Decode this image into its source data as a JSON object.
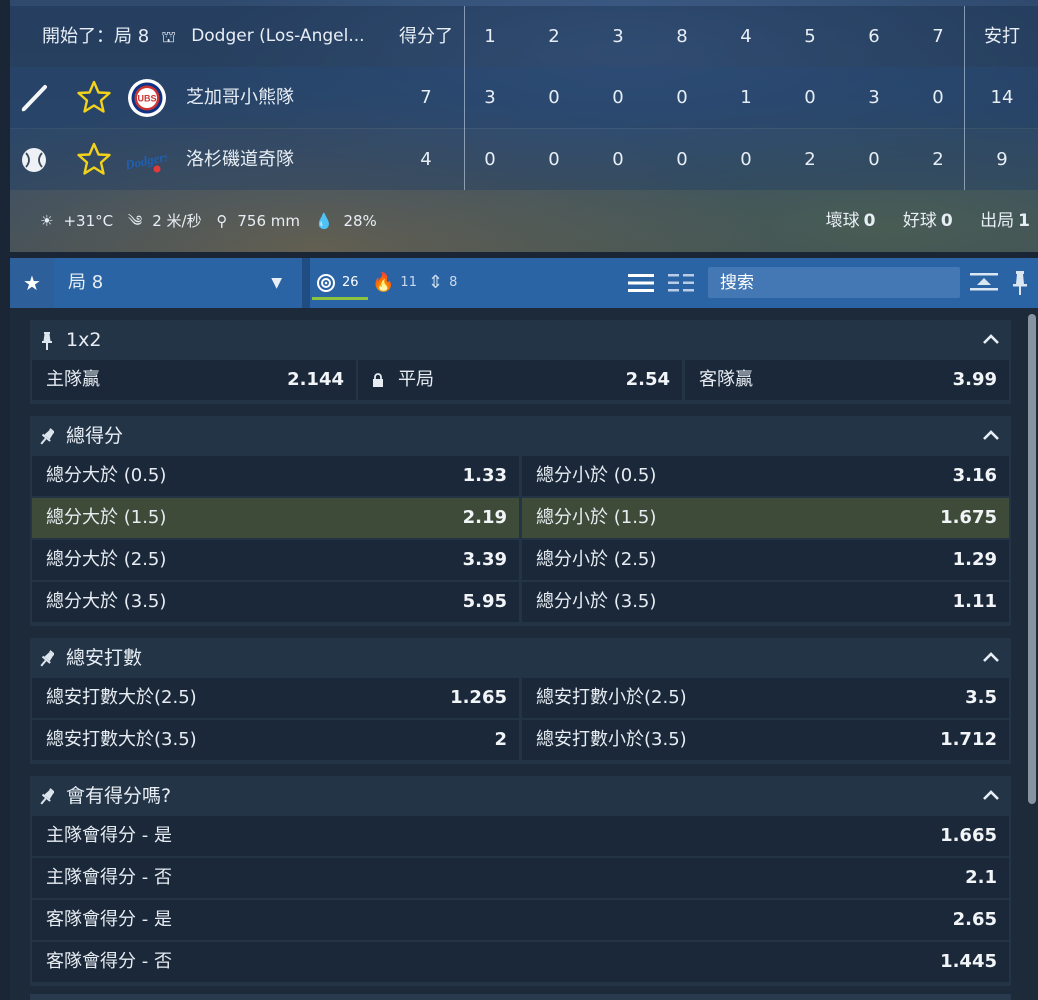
{
  "scoreboard": {
    "status": "開始了：局 8",
    "match": "Dodger (Los-Angel...",
    "runs_header": "得分了",
    "innings": [
      "1",
      "2",
      "3",
      "8",
      "4",
      "5",
      "6",
      "7"
    ],
    "hits_header": "安打",
    "home": {
      "name": "芝加哥小熊隊",
      "runs": "7",
      "scores": [
        "3",
        "0",
        "0",
        "0",
        "1",
        "0",
        "3",
        "0"
      ],
      "hits": "14",
      "logo": "Cubs"
    },
    "away": {
      "name": "洛杉磯道奇隊",
      "runs": "4",
      "scores": [
        "0",
        "0",
        "0",
        "0",
        "0",
        "2",
        "0",
        "2"
      ],
      "hits": "9",
      "logo": "Dodgers"
    },
    "weather": {
      "temp": "+31°C",
      "wind": "2 米/秒",
      "pressure": "756 mm",
      "humidity": "28%"
    },
    "counts": {
      "balls_label": "壞球",
      "balls": "0",
      "strikes_label": "好球",
      "strikes": "0",
      "outs_label": "出局",
      "outs": "1"
    }
  },
  "toolbar": {
    "inning": "局 8",
    "filter_all": "26",
    "filter_hot": "11",
    "filter_sort": "8",
    "search_placeholder": "搜索"
  },
  "markets": [
    {
      "title": "1x2",
      "rows": [
        [
          {
            "label": "主隊贏",
            "value": "2.144"
          },
          {
            "label": "平局",
            "value": "2.54",
            "locked": true
          },
          {
            "label": "客隊贏",
            "value": "3.99"
          }
        ]
      ]
    },
    {
      "title": "總得分",
      "rows": [
        [
          {
            "label": "總分大於 (0.5)",
            "value": "1.33"
          },
          {
            "label": "總分小於 (0.5)",
            "value": "3.16"
          }
        ],
        [
          {
            "label": "總分大於 (1.5)",
            "value": "2.19"
          },
          {
            "label": "總分小於 (1.5)",
            "value": "1.675"
          }
        ],
        [
          {
            "label": "總分大於 (2.5)",
            "value": "3.39"
          },
          {
            "label": "總分小於 (2.5)",
            "value": "1.29"
          }
        ],
        [
          {
            "label": "總分大於 (3.5)",
            "value": "5.95"
          },
          {
            "label": "總分小於 (3.5)",
            "value": "1.11"
          }
        ]
      ]
    },
    {
      "title": "總安打數",
      "rows": [
        [
          {
            "label": "總安打數大於(2.5)",
            "value": "1.265"
          },
          {
            "label": "總安打數小於(2.5)",
            "value": "3.5"
          }
        ],
        [
          {
            "label": "總安打數大於(3.5)",
            "value": "2"
          },
          {
            "label": "總安打數小於(3.5)",
            "value": "1.712"
          }
        ]
      ]
    },
    {
      "title": "會有得分嗎?",
      "rows": [
        [
          {
            "label": "主隊會得分 - 是",
            "value": "1.665"
          }
        ],
        [
          {
            "label": "主隊會得分 - 否",
            "value": "2.1"
          }
        ],
        [
          {
            "label": "客隊會得分 - 是",
            "value": "2.65"
          }
        ],
        [
          {
            "label": "客隊會得分 - 否",
            "value": "1.445"
          }
        ]
      ]
    }
  ],
  "colors": {
    "highlight": "#3e4b38",
    "toolbar": "#2a64a4",
    "star": "#f2d21b",
    "active_filter": "#8dc43f"
  }
}
